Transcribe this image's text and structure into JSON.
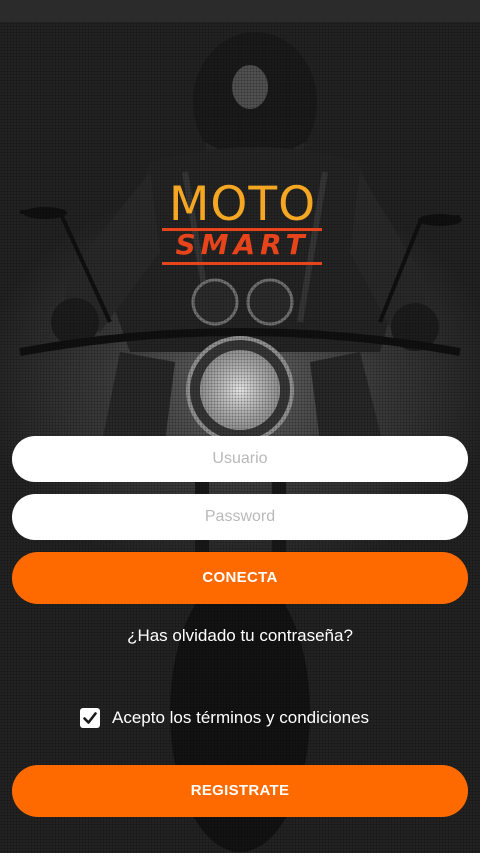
{
  "logo": {
    "line1": "MOTO",
    "line2": "SMART"
  },
  "login": {
    "username_placeholder": "Usuario",
    "password_placeholder": "Password",
    "connect_label": "CONECTA",
    "forgot_label": "¿Has olvidado tu contraseña?"
  },
  "terms": {
    "label": "Acepto los términos y condiciones",
    "checked": true
  },
  "register": {
    "label": "REGISTRATE"
  },
  "colors": {
    "accent": "#ff6a00",
    "logo_orange": "#f5a623",
    "logo_red": "#e8441c"
  }
}
